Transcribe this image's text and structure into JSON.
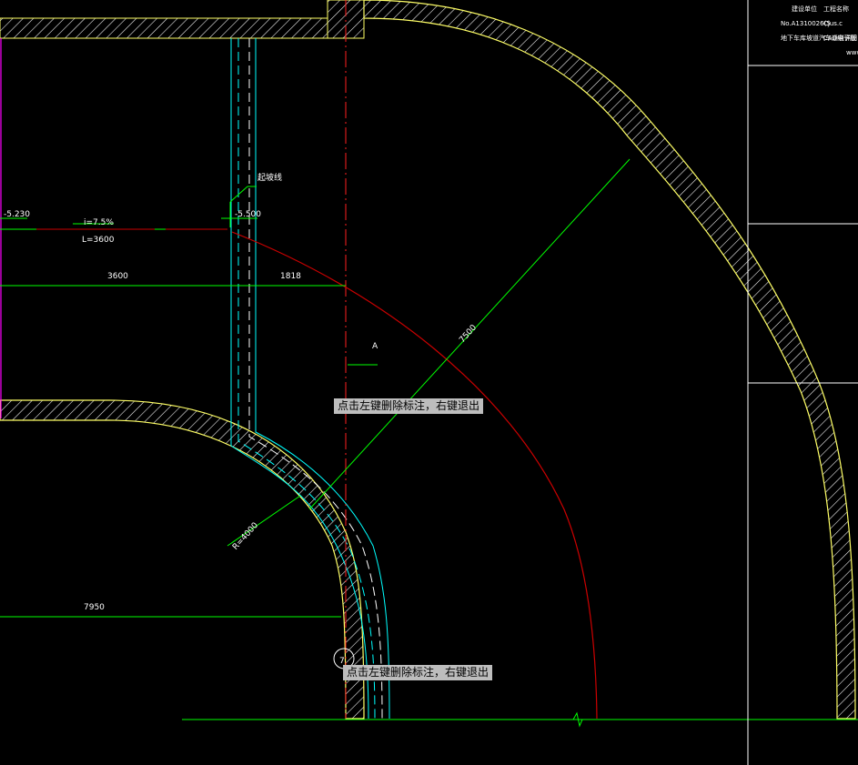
{
  "labels": {
    "elev_left": "-5.230",
    "elev_right": "-5.500",
    "slope": "i=7.5%",
    "length": "L=3600",
    "start_line": "起坡线",
    "dim_3600": "3600",
    "dim_1818": "1818",
    "dim_7500": "7500",
    "dim_7950": "7950",
    "dim_r4000": "R=4000",
    "point_a": "A",
    "circle_mark": "7"
  },
  "tooltips": {
    "top": "点击左键删除标注，右键退出",
    "bottom": "点击左键删除标注，右键退出"
  },
  "title_block": {
    "row1_a": "建设单位",
    "row1_b": "工程名称",
    "row2_a": "No.A1310026(5",
    "row2_b": "Cjus.c",
    "row3_a": "地下车库坡道汽车通道详图",
    "row3_b": "CAD电子版",
    "row4": "www"
  },
  "colors": {
    "wall": "#ffff66",
    "hatch": "#ffffff",
    "dimension": "#00ff00",
    "axis": "#ff2020",
    "curve_red": "#cc0000",
    "lane": "#00ffff",
    "magenta": "#ff00ff"
  }
}
